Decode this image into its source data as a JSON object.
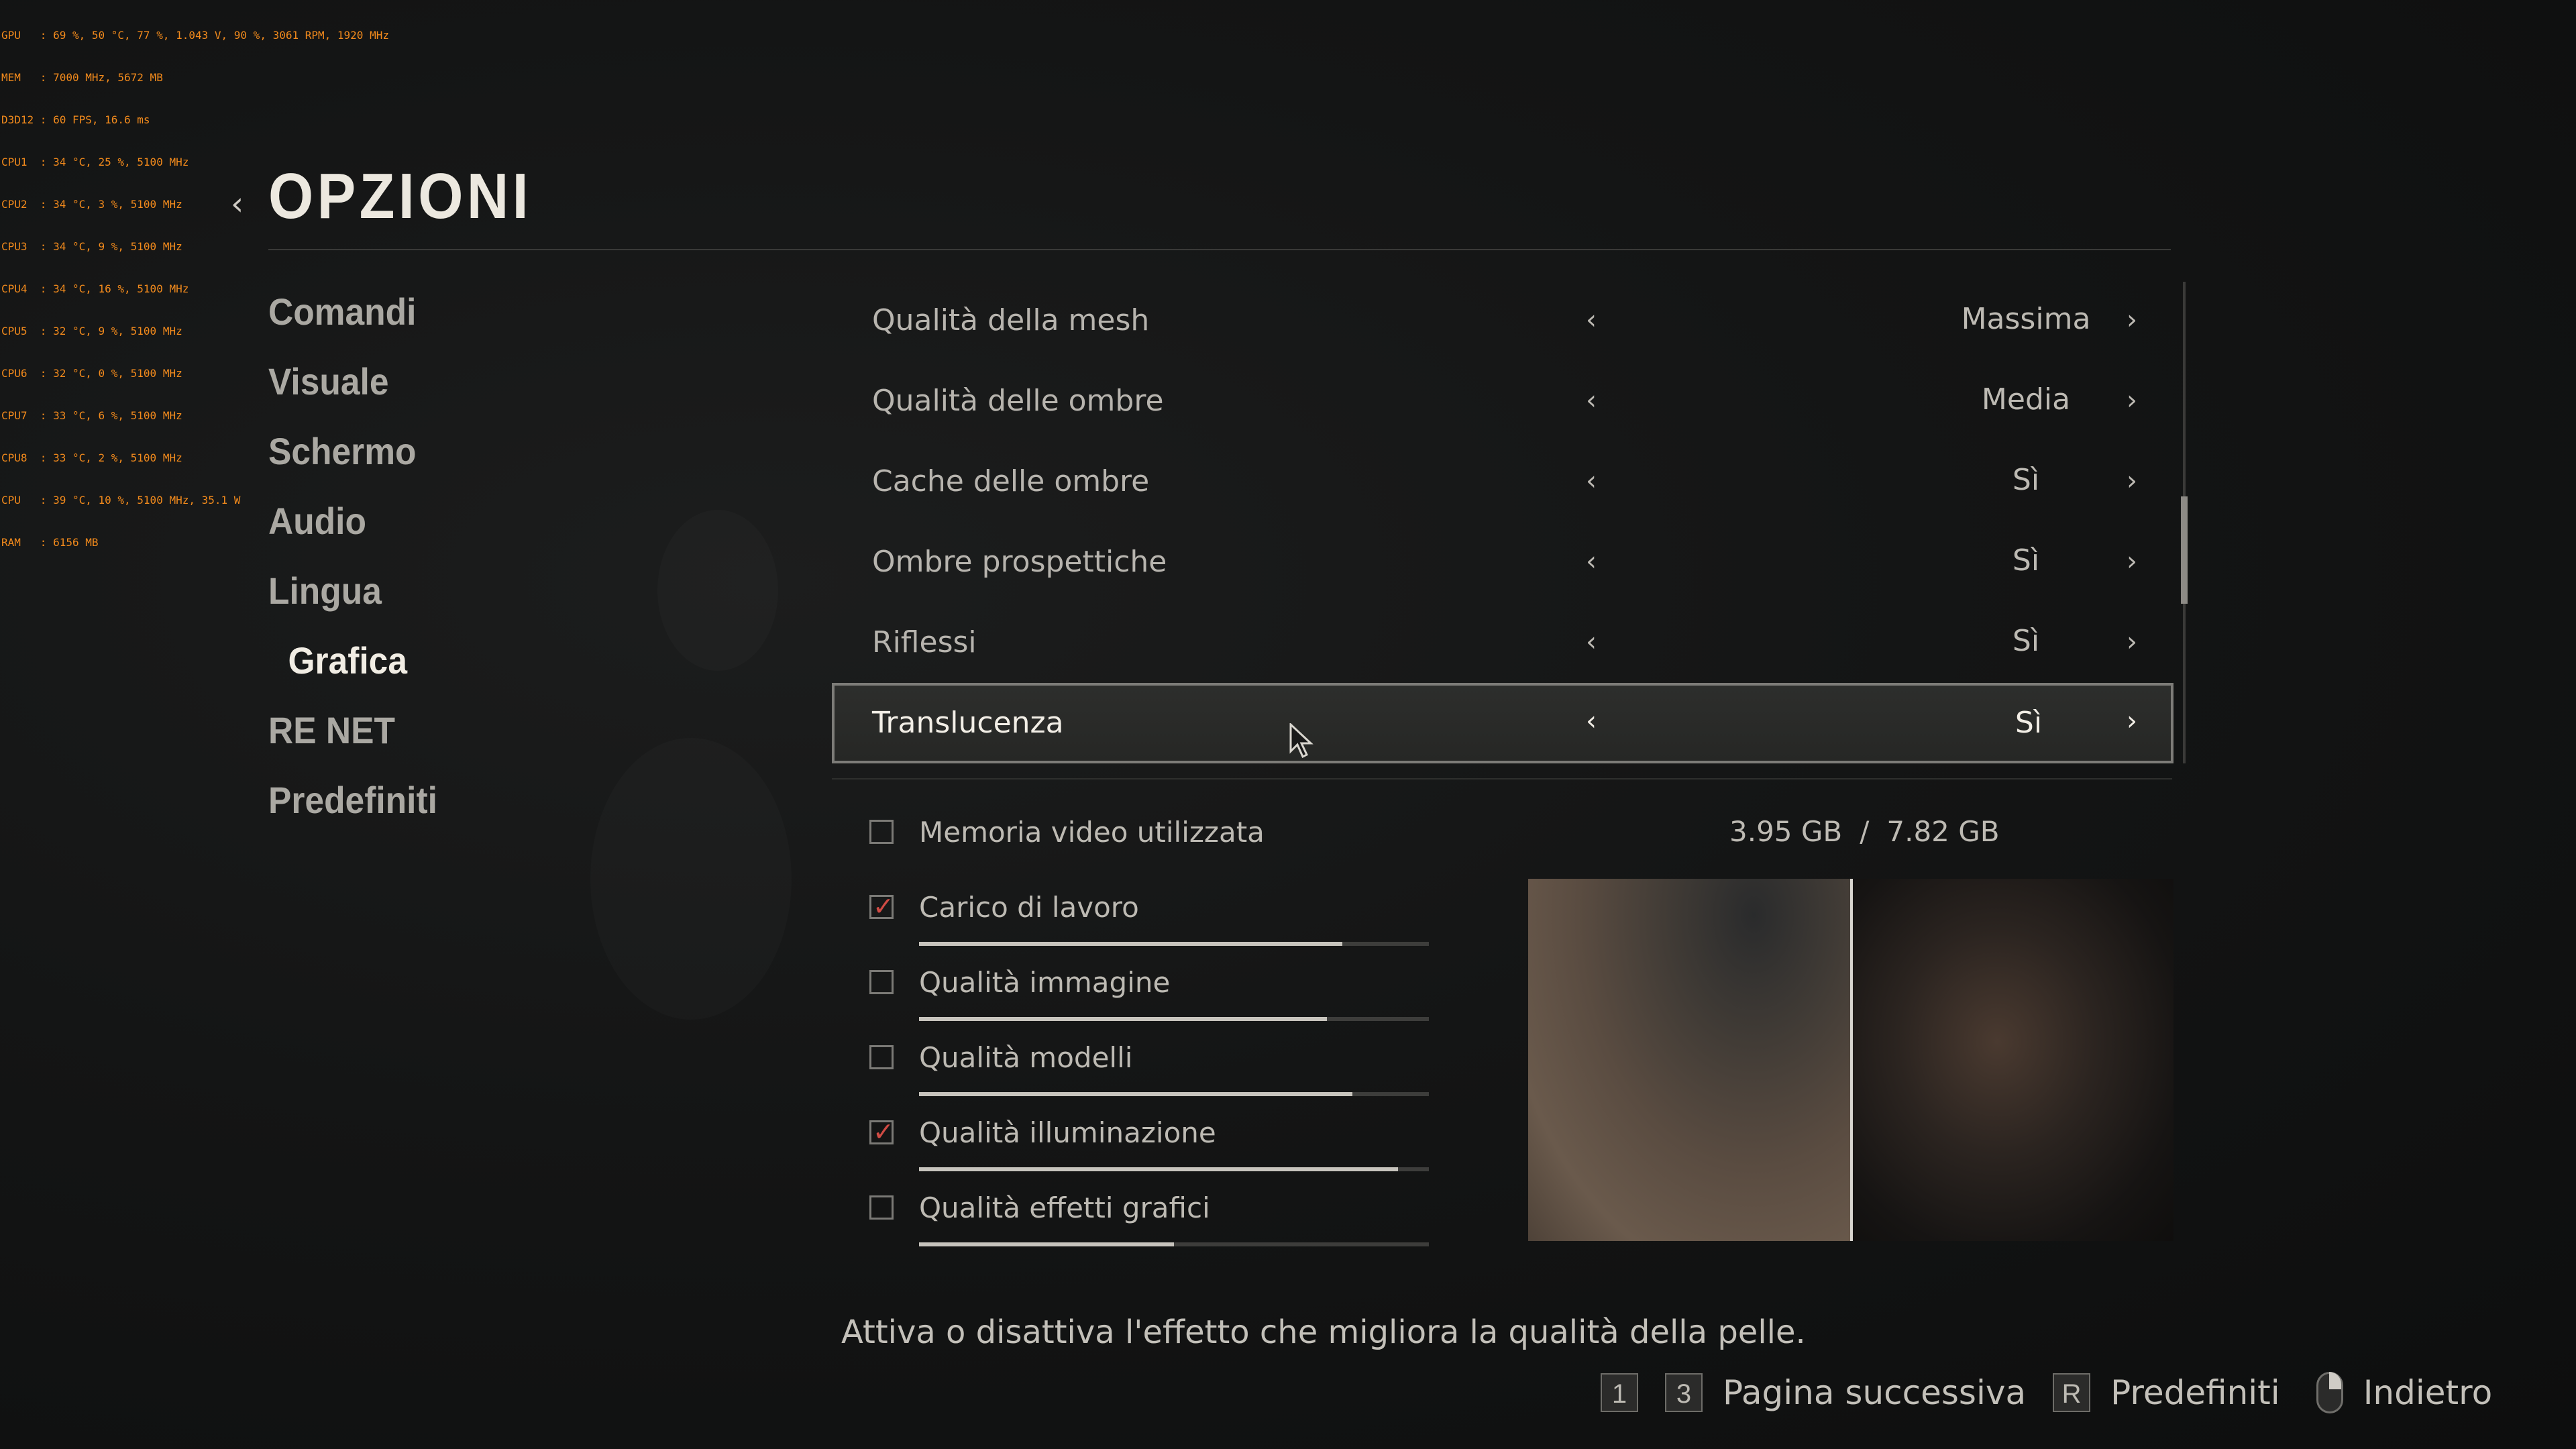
{
  "overlay_stats": [
    "GPU   : 69 %, 50 °C, 77 %, 1.043 V, 90 %, 3061 RPM, 1920 MHz",
    "MEM   : 7000 MHz, 5672 MB",
    "D3D12 : 60 FPS, 16.6 ms",
    "CPU1  : 34 °C, 25 %, 5100 MHz",
    "CPU2  : 34 °C, 3 %, 5100 MHz",
    "CPU3  : 34 °C, 9 %, 5100 MHz",
    "CPU4  : 34 °C, 16 %, 5100 MHz",
    "CPU5  : 32 °C, 9 %, 5100 MHz",
    "CPU6  : 32 °C, 0 %, 5100 MHz",
    "CPU7  : 33 °C, 6 %, 5100 MHz",
    "CPU8  : 33 °C, 2 %, 5100 MHz",
    "CPU   : 39 °C, 10 %, 5100 MHz, 35.1 W",
    "RAM   : 6156 MB"
  ],
  "header": {
    "back_glyph": "‹",
    "title": "OPZIONI"
  },
  "nav": {
    "items": [
      {
        "label": "Comandi"
      },
      {
        "label": "Visuale"
      },
      {
        "label": "Schermo"
      },
      {
        "label": "Audio"
      },
      {
        "label": "Lingua"
      },
      {
        "label": "Grafica",
        "active": true
      },
      {
        "label": "RE NET"
      },
      {
        "label": "Predefiniti"
      }
    ]
  },
  "settings": {
    "arrow_left": "‹",
    "arrow_right": "›",
    "rows": [
      {
        "label": "Qualità della mesh",
        "value": "Massima"
      },
      {
        "label": "Qualità delle ombre",
        "value": "Media"
      },
      {
        "label": "Cache delle ombre",
        "value": "Sì"
      },
      {
        "label": "Ombre prospettiche",
        "value": "Sì"
      },
      {
        "label": "Riflessi",
        "value": "Sì"
      },
      {
        "label": "Translucenza",
        "value": "Sì",
        "selected": true
      }
    ]
  },
  "vram": {
    "label": "Memoria video utilizzata",
    "used": "3.95 GB",
    "separator": "/",
    "total": "7.82 GB"
  },
  "metrics": [
    {
      "label": "Carico di lavoro",
      "checked": true,
      "level": 0.83
    },
    {
      "label": "Qualità immagine",
      "checked": false,
      "level": 0.8
    },
    {
      "label": "Qualità modelli",
      "checked": false,
      "level": 0.85
    },
    {
      "label": "Qualità illuminazione",
      "checked": true,
      "level": 0.94
    },
    {
      "label": "Qualità effetti grafici",
      "checked": false,
      "level": 0.5
    }
  ],
  "scrollbar": {
    "position": 0.45
  },
  "description": "Attiva o disattiva l'effetto che migliora la qualità della pelle.",
  "footer": {
    "key1": "1",
    "key3": "3",
    "next_page": "Pagina successiva",
    "keyR": "R",
    "defaults": "Predefiniti",
    "back": "Indietro"
  },
  "colors": {
    "accent_check": "#d04b44",
    "text": "#c3c0b9",
    "title": "#ece8df"
  }
}
